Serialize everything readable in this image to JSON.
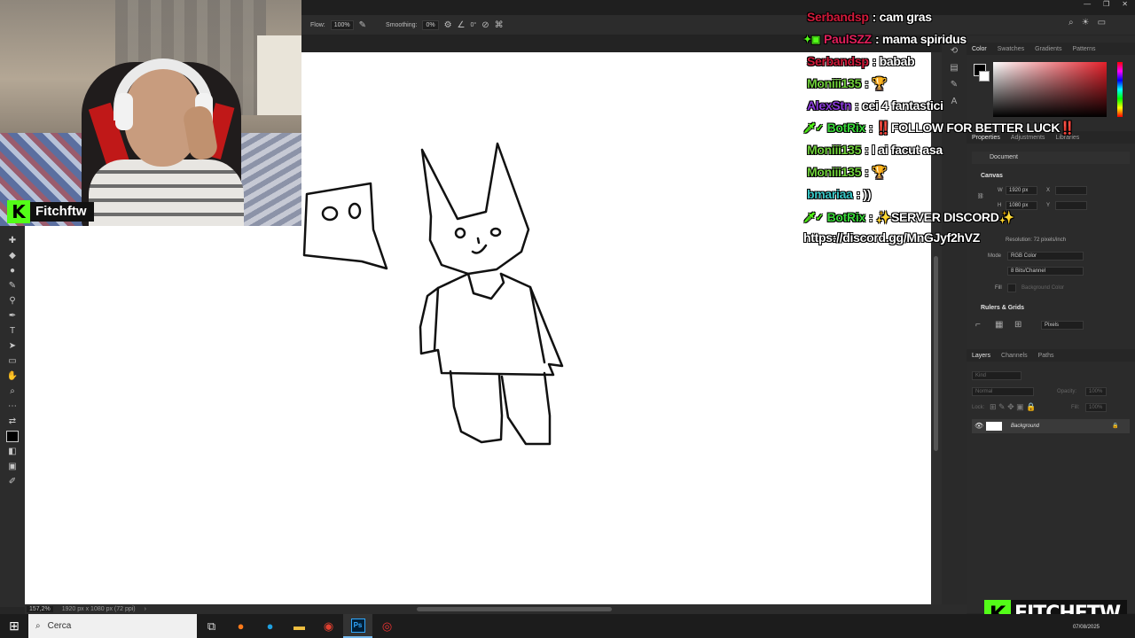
{
  "options_bar": {
    "flow_label": "Flow:",
    "flow_value": "100%",
    "smoothing_label": "Smoothing:",
    "smoothing_value": "0%",
    "angle_value": "0°"
  },
  "status_bar": {
    "zoom": "157,2%",
    "doc_size": "1920 px x 1080 px (72 ppi)"
  },
  "color_panel": {
    "tabs": [
      "Color",
      "Swatches",
      "Gradients",
      "Patterns"
    ]
  },
  "properties_panel": {
    "tabs": [
      "Properties",
      "Adjustments",
      "Libraries"
    ],
    "document_label": "Document",
    "canvas_header": "Canvas",
    "w_label": "W",
    "w_value": "1920 px",
    "x_label": "X",
    "h_label": "H",
    "h_value": "1080 px",
    "y_label": "Y",
    "resolution": "Resolution: 72 pixels/inch",
    "mode_label": "Mode",
    "mode_value": "RGB Color",
    "bits_value": "8 Bits/Channel",
    "fill_label": "Fill",
    "fill_value": "Background Color",
    "rulers_header": "Rulers & Grids",
    "units_value": "Pixels"
  },
  "layers_panel": {
    "tabs": [
      "Layers",
      "Channels",
      "Paths"
    ],
    "kind_placeholder": "Kind",
    "blend_mode": "Normal",
    "opacity_label": "Opacity:",
    "opacity_value": "100%",
    "lock_label": "Lock:",
    "fill_label": "Fill:",
    "fill_value": "100%",
    "layer_name": "Background"
  },
  "webcam": {
    "channel_name": "Fitchftw",
    "logo_letter": "K"
  },
  "chat": [
    {
      "user": "Serbandsp",
      "text": ": cam gras",
      "color": "#d01a3a",
      "badge": ""
    },
    {
      "user": "PaulSZZ",
      "text": ": mama spiridus",
      "color": "#e0205a",
      "badge": "✦▣"
    },
    {
      "user": "Serbandsp",
      "text": ": babab",
      "color": "#d01a3a",
      "badge": ""
    },
    {
      "user": "Moniii135",
      "text": ": 🏆",
      "color": "#6fcf3a",
      "badge": ""
    },
    {
      "user": "AlexStn",
      "text": ": cei 4 fantastici",
      "color": "#8a3ad8",
      "badge": ""
    },
    {
      "user": "BotRix",
      "text": ": ‼️FOLLOW FOR BETTER LUCK‼️",
      "color": "#3ad93a",
      "badge": "🗡✓"
    },
    {
      "user": "Moniii135",
      "text": ": l ai facut asa",
      "color": "#6fcf3a",
      "badge": ""
    },
    {
      "user": "Moniii135",
      "text": ": 🏆",
      "color": "#6fcf3a",
      "badge": ""
    },
    {
      "user": "bmariaa",
      "text": ": ))",
      "color": "#3ac8c8",
      "badge": ""
    },
    {
      "user": "BotRix",
      "text": ": ✨SERVER DISCORD✨",
      "color": "#3ad93a",
      "badge": "🗡✓"
    }
  ],
  "chat_link": "https://discord.gg/MnGJyf2hVZ",
  "watermark": {
    "logo_letter": "K",
    "text": "FITCHFTW"
  },
  "taskbar": {
    "search_placeholder": "Cerca",
    "date": "07/08/2025"
  }
}
